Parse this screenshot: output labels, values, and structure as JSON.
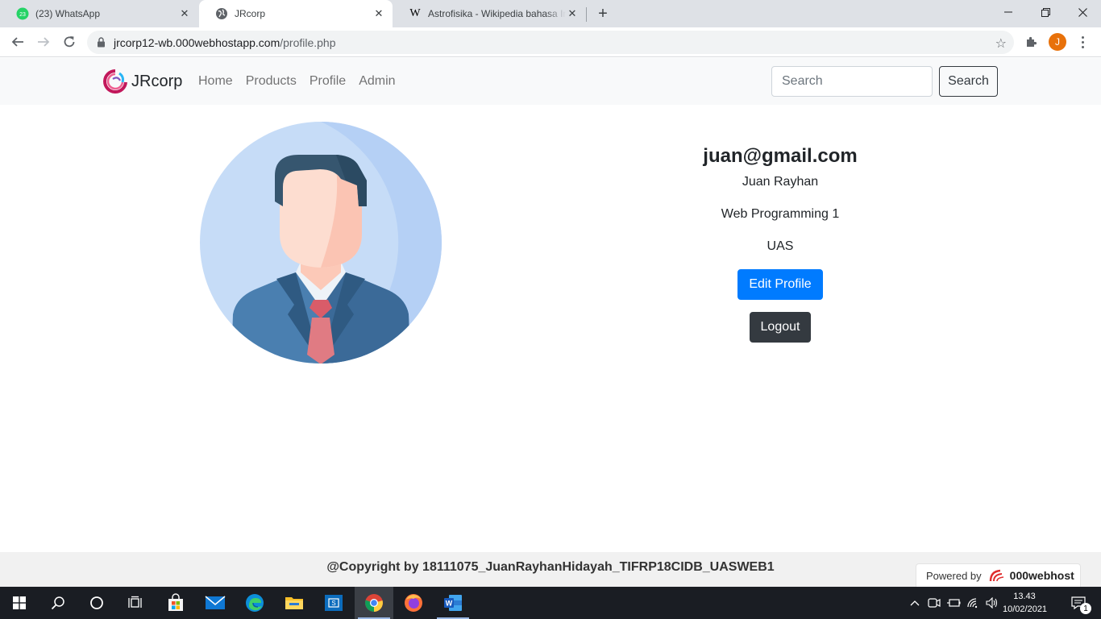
{
  "browser": {
    "tabs": [
      {
        "title": "(23) WhatsApp",
        "badge": "23",
        "active": false
      },
      {
        "title": "JRcorp",
        "active": true
      },
      {
        "title": "Astrofisika - Wikipedia bahasa Indonesia",
        "favicon_letter": "W",
        "active": false
      }
    ],
    "new_tab_label": "+",
    "url_domain": "jrcorp12-wb.000webhostapp.com",
    "url_path": "/profile.php",
    "profile_initial": "J",
    "accent_color": "#e8710a"
  },
  "site": {
    "brand": "JRcorp",
    "nav_links": [
      "Home",
      "Products",
      "Profile",
      "Admin"
    ],
    "search": {
      "placeholder": "Search",
      "button_label": "Search"
    }
  },
  "profile": {
    "email": "juan@gmail.com",
    "name": "Juan Rayhan",
    "course": "Web Programming 1",
    "type": "UAS",
    "edit_label": "Edit Profile",
    "logout_label": "Logout",
    "edit_color": "#007bff",
    "logout_color": "#343a40"
  },
  "footer": {
    "copyright": "@Copyright by 18111075_JuanRayhanHidayah_TIFRP18CIDB_UASWEB1",
    "powered_label": "Powered by",
    "powered_brand": "000webhost"
  },
  "taskbar": {
    "apps": [
      "start-icon",
      "search-icon",
      "cortana-icon",
      "task-view-icon",
      "store-icon",
      "mail-icon",
      "edge-icon",
      "file-explorer-icon",
      "sway-icon",
      "chrome-icon",
      "firefox-icon",
      "word-icon"
    ],
    "time": "13.43",
    "date": "10/02/2021",
    "notification_count": "1"
  }
}
